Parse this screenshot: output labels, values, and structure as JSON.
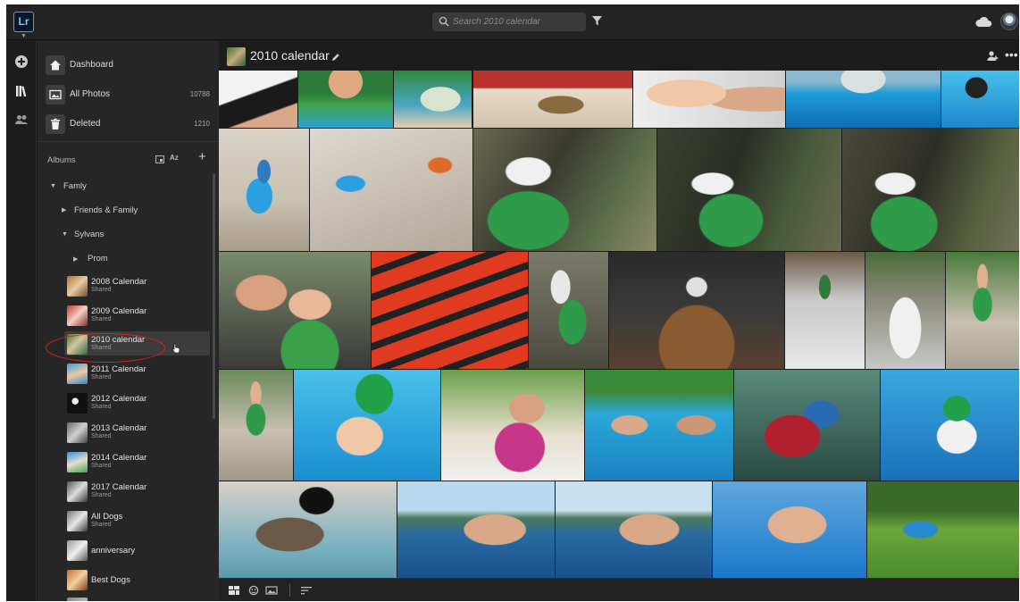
{
  "app": {
    "logo_text": "Lr"
  },
  "search": {
    "placeholder": "Search 2010 calendar"
  },
  "nav": [
    {
      "label": "Dashboard",
      "count": "",
      "icon": "home-icon"
    },
    {
      "label": "All Photos",
      "count": "10788",
      "icon": "photos-icon"
    },
    {
      "label": "Deleted",
      "count": "1210",
      "icon": "trash-icon"
    }
  ],
  "albums": {
    "header": "Albums",
    "sort_label": "Az",
    "folders": {
      "family": "Famly",
      "friends": "Friends & Family",
      "sylvans": "Sylvans",
      "prom": "Prom"
    },
    "items": [
      {
        "name": "2008 Calendar",
        "sub": "Shared"
      },
      {
        "name": "2009 Calendar",
        "sub": "Shared"
      },
      {
        "name": "2010 calendar",
        "sub": "Shared"
      },
      {
        "name": "2011 Calendar",
        "sub": "Shared"
      },
      {
        "name": "2012 Calendar",
        "sub": "Shared"
      },
      {
        "name": "2013 Calendar",
        "sub": "Shared"
      },
      {
        "name": "2014 Calendar",
        "sub": "Shared"
      },
      {
        "name": "2017 Calendar",
        "sub": "Shared"
      },
      {
        "name": "All Dogs",
        "sub": "Shared"
      },
      {
        "name": "anniversary",
        "sub": ""
      },
      {
        "name": "Best Dogs",
        "sub": ""
      }
    ],
    "selected": "2010 calendar"
  },
  "main": {
    "album_title": "2010 calendar"
  },
  "colors": {
    "accent": "#4a9fe8",
    "selection_ellipse": "#dd2222",
    "background": "#1d1d1d",
    "sidebar": "#262626"
  }
}
